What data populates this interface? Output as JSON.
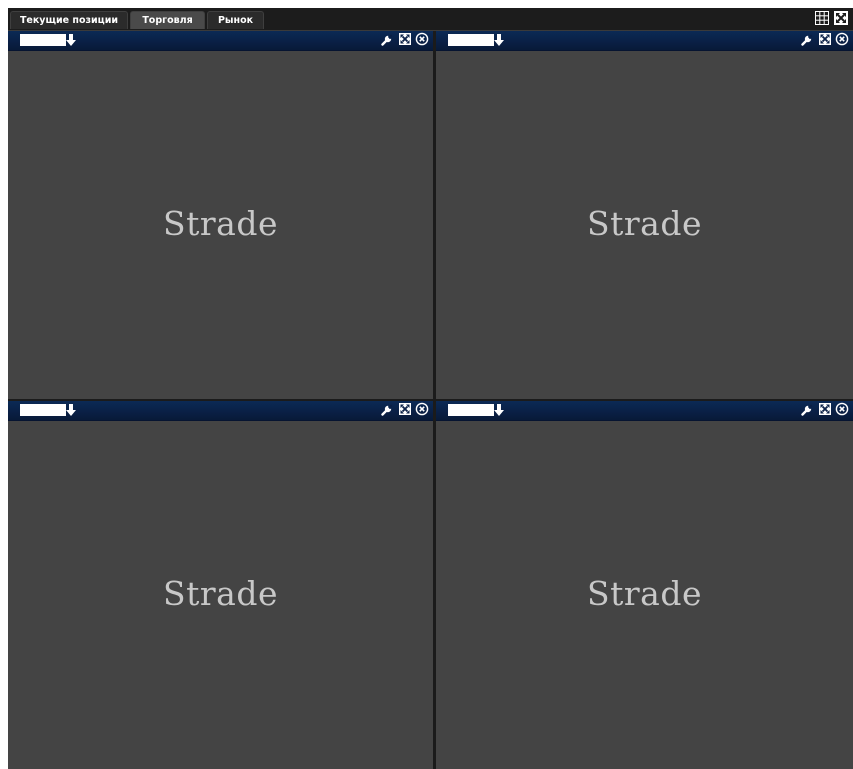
{
  "tabs": [
    {
      "label": "Текущие позиции",
      "active": false
    },
    {
      "label": "Торговля",
      "active": true
    },
    {
      "label": "Рынок",
      "active": false
    }
  ],
  "toolbar_icons": [
    "grid-layout-icon",
    "fullscreen-icon"
  ],
  "panels": [
    {
      "symbol_value": "",
      "watermark": "Strade"
    },
    {
      "symbol_value": "",
      "watermark": "Strade"
    },
    {
      "symbol_value": "",
      "watermark": "Strade"
    },
    {
      "symbol_value": "",
      "watermark": "Strade"
    }
  ],
  "panel_icons": [
    "down-arrow-icon",
    "wrench-icon",
    "expand-icon",
    "close-icon"
  ],
  "colors": {
    "background": "#444444",
    "titlebar": "#0a2046",
    "tabbar": "#1c1c1c",
    "watermark_text": "#c8c8c8"
  }
}
